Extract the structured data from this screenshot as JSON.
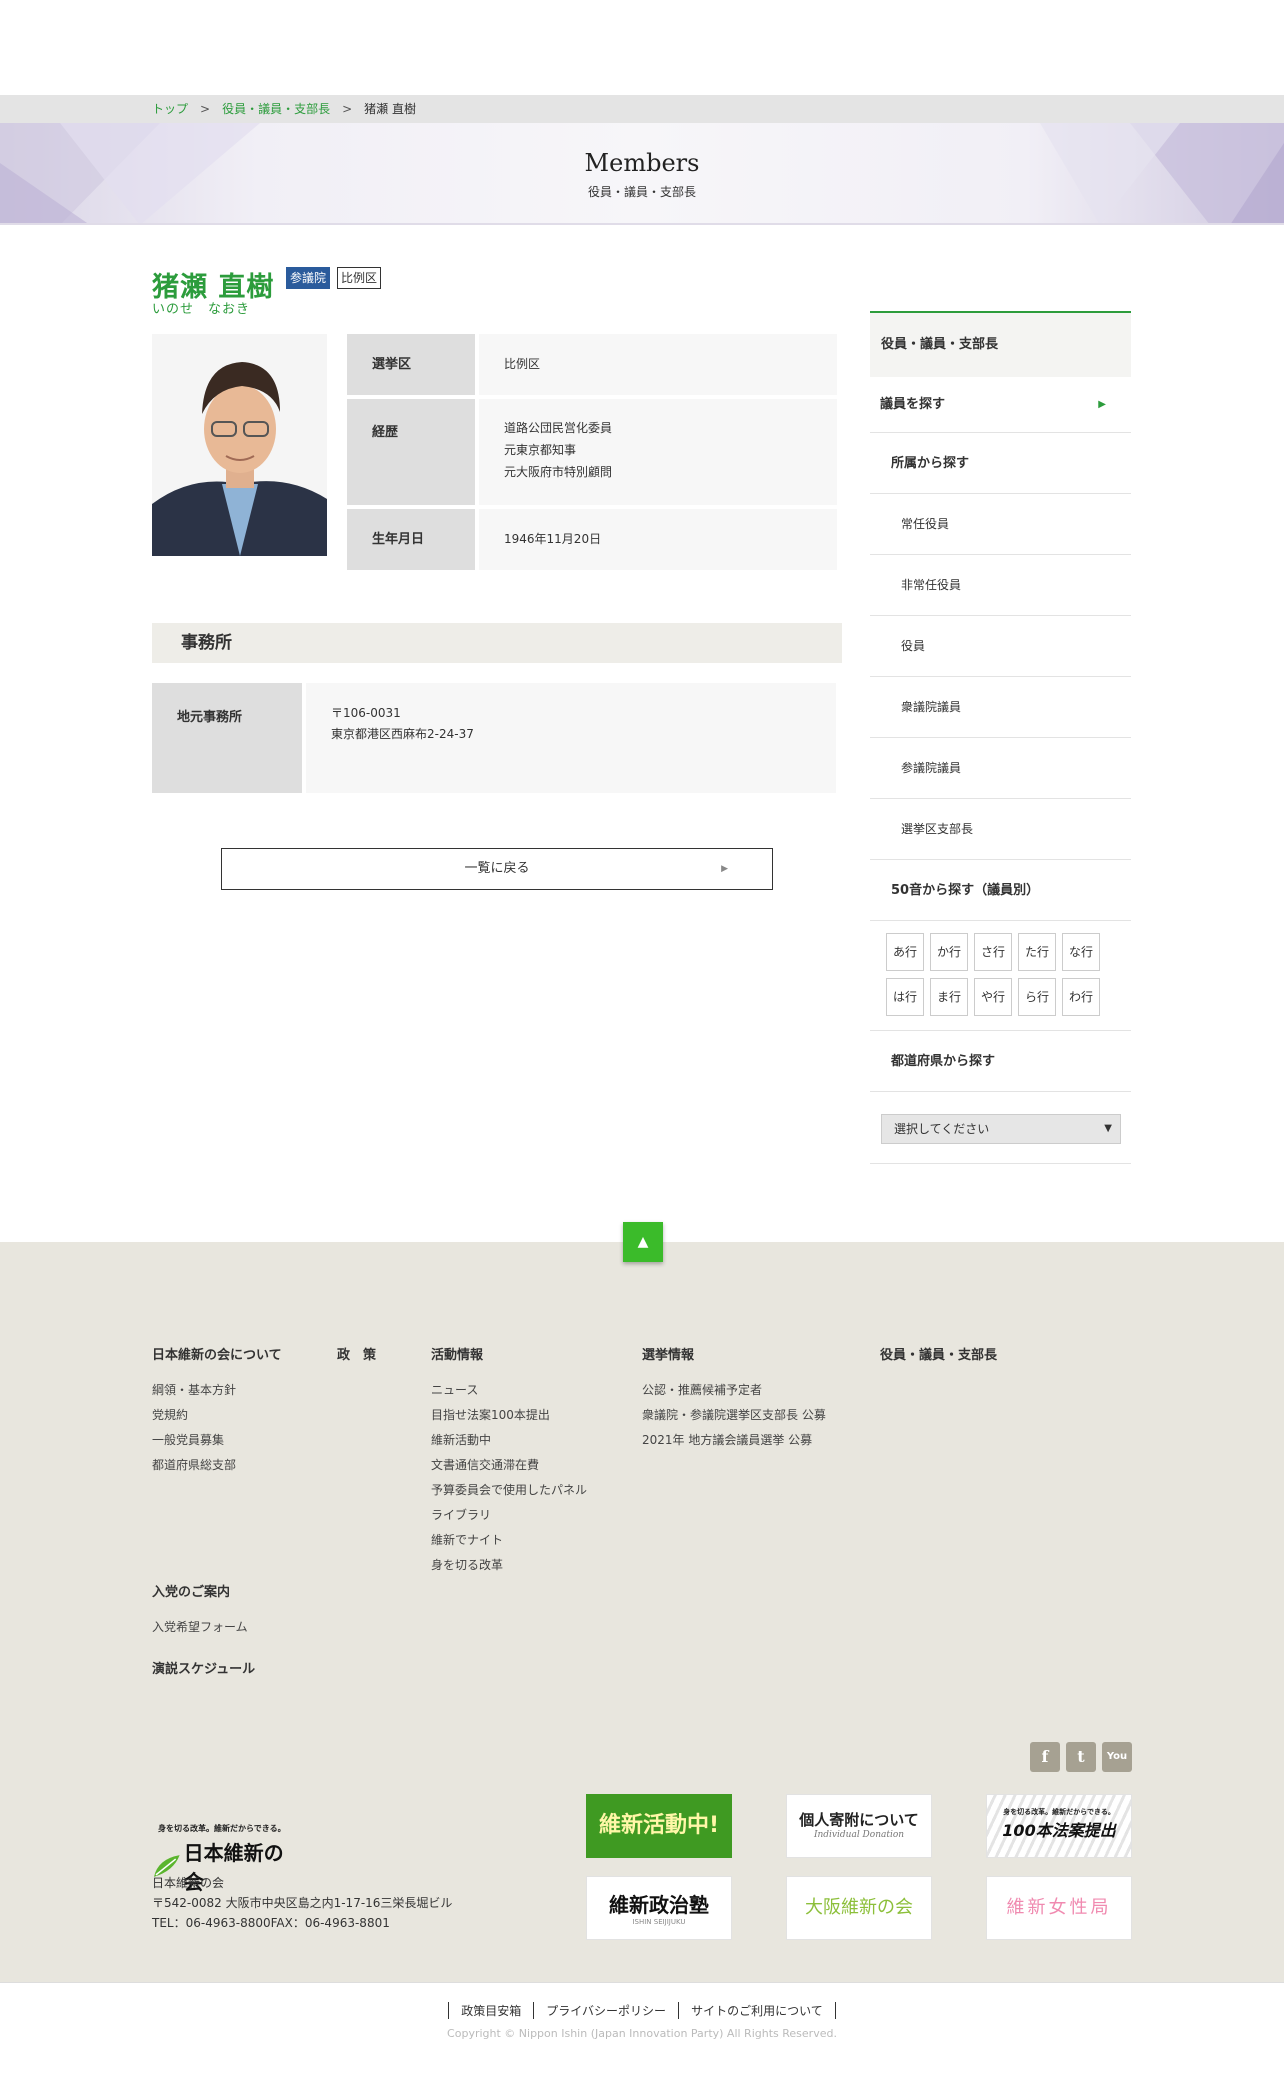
{
  "breadcrumb": {
    "home": "トップ",
    "section": "役員・議員・支部長",
    "current": "猪瀬 直樹",
    "separator": ">"
  },
  "hero": {
    "title": "Members",
    "subtitle": "役員・議員・支部長"
  },
  "member": {
    "name": "猪瀬 直樹",
    "kana": "いのせ　なおき",
    "badge_house": "参議院",
    "badge_block": "比例区",
    "rows": {
      "district_label": "選挙区",
      "district_value": "比例区",
      "career_label": "経歴",
      "career_lines": [
        "道路公団民営化委員",
        "元東京都知事",
        "元大阪府市特別顧問"
      ],
      "birth_label": "生年月日",
      "birth_value": "1946年11月20日"
    }
  },
  "office": {
    "heading": "事務所",
    "label": "地元事務所",
    "postal": "〒106-0031",
    "address": "東京都港区西麻布2-24-37"
  },
  "back_button": {
    "label": "一覧に戻る",
    "arrow": "▶"
  },
  "sidebar": {
    "heading": "役員・議員・支部長",
    "find": "議員を探す",
    "find_arrow": "▶",
    "by_affiliation": "所属から探す",
    "affiliation_items": [
      "常任役員",
      "非常任役員",
      "役員",
      "衆議院議員",
      "参議院議員",
      "選挙区支部長"
    ],
    "by_kana": "50音から探す（議員別）",
    "kana_buttons": [
      "あ行",
      "か行",
      "さ行",
      "た行",
      "な行",
      "は行",
      "ま行",
      "や行",
      "ら行",
      "わ行"
    ],
    "by_prefecture": "都道府県から探す",
    "prefecture_select": "選択してください"
  },
  "to_top": "▲",
  "footer": {
    "about": {
      "heading": "日本維新の会について",
      "links": [
        "綱領・基本方針",
        "党規約",
        "一般党員募集",
        "都道府県総支部"
      ]
    },
    "policy": {
      "heading": "政　策"
    },
    "activity": {
      "heading": "活動情報",
      "links": [
        "ニュース",
        "目指せ法案100本提出",
        "維新活動中",
        "文書通信交通滞在費",
        "予算委員会で使用したパネル",
        "ライブラリ",
        "維新でナイト",
        "身を切る改革"
      ]
    },
    "election": {
      "heading": "選挙情報",
      "links": [
        "公認・推薦候補予定者",
        "衆議院・参議院選挙区支部長 公募",
        "2021年 地方議会議員選挙 公募"
      ]
    },
    "members": {
      "heading": "役員・議員・支部長"
    },
    "join": {
      "heading": "入党のご案内",
      "links": [
        "入党希望フォーム"
      ]
    },
    "schedule": {
      "heading": "演説スケジュール"
    },
    "sns": {
      "facebook": "f",
      "twitter": "t",
      "youtube": "You"
    },
    "logo": {
      "tagline": "身を切る改革。維新だからできる。",
      "name": "日本維新の会"
    },
    "org": {
      "name": "日本維新の会",
      "address": "〒542-0082 大阪市中央区島之内1-17-16三栄長堀ビル",
      "tel": "TEL：06-4963-8800FAX：06-4963-8801"
    },
    "banners": {
      "activity": "維新活動中!",
      "donation_main": "個人寄附について",
      "donation_sub": "Individual Donation",
      "bills_tagline": "身を切る改革。維新だからできる。",
      "bills_main": "100本法案提出",
      "school": "維新政治塾",
      "school_sub": "ISHIN SEIJIJUKU",
      "osaka": "大阪維新の会",
      "women": "維新女性局"
    },
    "bottom_links": [
      "政策目安箱",
      "プライバシーポリシー",
      "サイトのご利用について"
    ],
    "copyright": "Copyright © Nippon Ishin (Japan Innovation Party) All Rights Reserved."
  },
  "colors": {
    "accent_green": "#2c9c3c",
    "badge_blue": "#2a5b9c",
    "top_button_green": "#3bbb2a",
    "footer_bg": "#e8e6de"
  }
}
